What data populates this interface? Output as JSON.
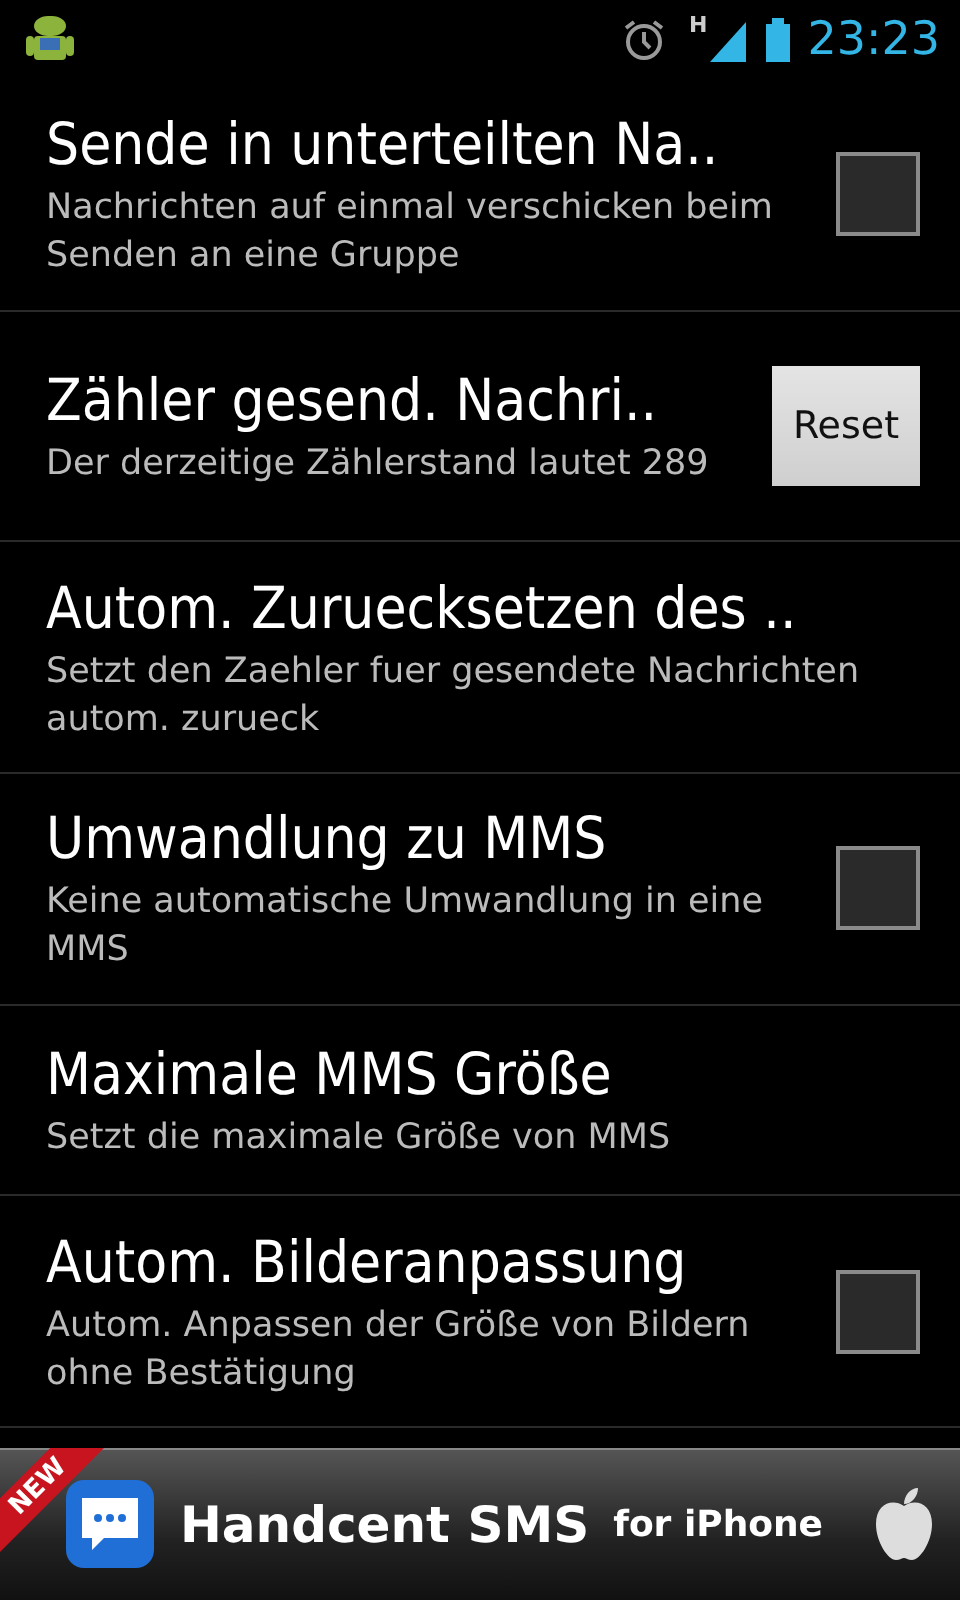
{
  "status_bar": {
    "time": "23:23",
    "network_type": "H"
  },
  "settings": [
    {
      "kind": "checkbox",
      "title": "Sende in unterteilten Na..",
      "summary": "Nachrichten auf einmal verschicken beim Senden an eine Gruppe",
      "checked": false
    },
    {
      "kind": "button",
      "title": "Zähler gesend. Nachri..",
      "summary": "Der derzeitige Zählerstand lautet 289",
      "button": "Reset"
    },
    {
      "kind": "plain",
      "title": "Autom. Zuruecksetzen des ..",
      "summary": "Setzt den Zaehler fuer gesendete Nachrichten autom. zurueck"
    },
    {
      "kind": "checkbox",
      "title": "Umwandlung zu MMS",
      "summary": "Keine automatische Umwandlung in eine MMS",
      "checked": false
    },
    {
      "kind": "plain",
      "title": "Maximale MMS Größe",
      "summary": "Setzt die maximale Größe von MMS"
    },
    {
      "kind": "checkbox",
      "title": "Autom. Bilderanpassung",
      "summary": "Autom. Anpassen der Größe von Bildern ohne Bestätigung",
      "checked": false
    }
  ],
  "ad_banner": {
    "badge": "NEW",
    "title": "Handcent SMS",
    "subtitle": "for iPhone"
  }
}
